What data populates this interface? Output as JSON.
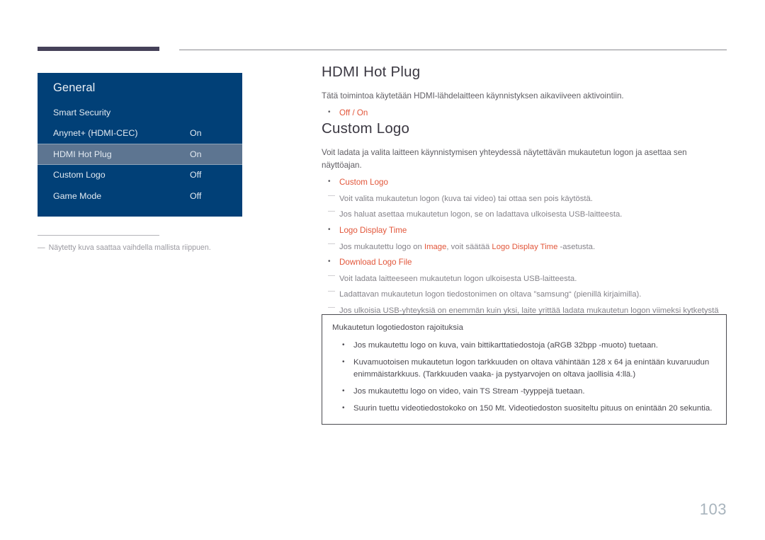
{
  "page": {
    "number": "103"
  },
  "osd": {
    "title": "General",
    "rows": [
      {
        "label": "Smart Security",
        "value": ""
      },
      {
        "label": "Anynet+ (HDMI-CEC)",
        "value": "On"
      },
      {
        "label": "HDMI Hot Plug",
        "value": "On"
      },
      {
        "label": "Custom Logo",
        "value": "Off"
      },
      {
        "label": "Game Mode",
        "value": "Off"
      }
    ],
    "selected_index": 2,
    "panel_color": "#014077",
    "selected_color": "#5d7591"
  },
  "left_footnote": {
    "dash": "―",
    "text": "Näytetty kuva saattaa vaihdella mallista riippuen."
  },
  "sections": {
    "hdmi_hot_plug": {
      "heading": "HDMI Hot Plug",
      "lead": "Tätä toimintoa käytetään HDMI-lähdelaitteen käynnistyksen aikaviiveen aktivointiin.",
      "option": "Off / On"
    },
    "custom_logo": {
      "heading": "Custom Logo",
      "lead": "Voit ladata ja valita laitteen käynnistymisen yhteydessä näytettävän mukautetun logon ja asettaa sen näyttöajan.",
      "item1_label": "Custom Logo",
      "item1_note1": "Voit valita mukautetun logon (kuva tai video) tai ottaa sen pois käytöstä.",
      "item1_note2": "Jos haluat asettaa mukautetun logon, se on ladattava ulkoisesta USB-laitteesta.",
      "item2_label": "Logo Display Time",
      "item2_note1_part1": "Jos mukautettu logo on ",
      "item2_note1_accent1": "Image",
      "item2_note1_part2": ", voit säätää ",
      "item2_note1_accent2": "Logo Display Time",
      "item2_note1_part3": " -asetusta.",
      "item3_label": "Download Logo File",
      "item3_note1": "Voit ladata laitteeseen mukautetun logon ulkoisesta USB-laitteesta.",
      "item3_note2": "Ladattavan mukautetun logon tiedostonimen on oltava ”samsung“ (pienillä kirjaimilla).",
      "item3_note3": "Jos ulkoisia USB-yhteyksiä on enemmän kuin yksi, laite yrittää ladata mukautetun logon viimeksi kytketystä USB-laitteesta."
    }
  },
  "note_box": {
    "title": "Mukautetun logotiedoston rajoituksia",
    "items": [
      "Jos mukautettu logo on kuva, vain bittikarttatiedostoja (aRGB 32bpp -muoto) tuetaan.",
      "Kuvamuotoisen mukautetun logon tarkkuuden on oltava vähintään 128 x 64 ja enintään kuvaruudun enimmäistarkkuus. (Tarkkuuden vaaka- ja pystyarvojen on oltava jaollisia 4:llä.)",
      "Jos mukautettu logo on video, vain TS Stream -tyyppejä tuetaan.",
      "Suurin tuettu videotiedostokoko on 150 Mt. Videotiedoston suositeltu pituus on enintään 20 sekuntia."
    ]
  },
  "colors": {
    "accent": "#e2563a",
    "heading": "#3b3842",
    "osd_panel": "#014077",
    "rule_thick": "#454159",
    "page_number": "#a8b4bd"
  }
}
